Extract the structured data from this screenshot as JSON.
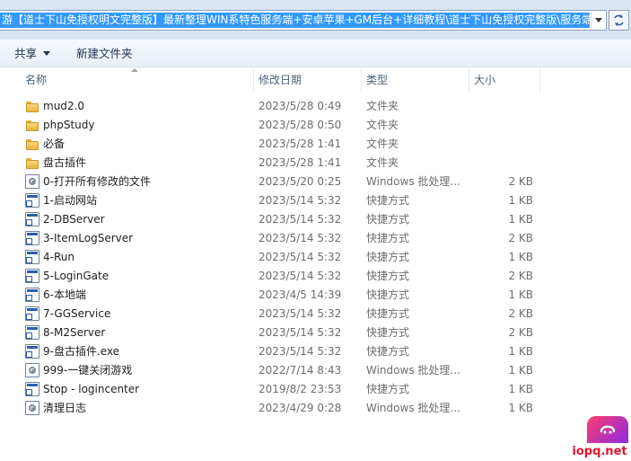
{
  "address_bar": {
    "path": "游【道士下山免授权明文完整版】最新整理WIN系特色服务端+安卓苹果+GM后台+详细教程\\道士下山免授权完整版\\服务端"
  },
  "toolbar": {
    "share_label": "共享",
    "new_folder_label": "新建文件夹"
  },
  "columns": {
    "name": "名称",
    "date": "修改日期",
    "type": "类型",
    "size": "大小"
  },
  "files": [
    {
      "name": "mud2.0",
      "date": "2023/5/28 0:49",
      "type": "文件夹",
      "size": "",
      "icon": "folder-icon"
    },
    {
      "name": "phpStudy",
      "date": "2023/5/28 0:50",
      "type": "文件夹",
      "size": "",
      "icon": "folder-icon"
    },
    {
      "name": "必备",
      "date": "2023/5/28 1:41",
      "type": "文件夹",
      "size": "",
      "icon": "folder-icon"
    },
    {
      "name": "盘古插件",
      "date": "2023/5/28 1:41",
      "type": "文件夹",
      "size": "",
      "icon": "folder-icon"
    },
    {
      "name": "0-打开所有修改的文件",
      "date": "2023/5/20 0:25",
      "type": "Windows 批处理...",
      "size": "2 KB",
      "icon": "batch-file-icon"
    },
    {
      "name": "1-启动网站",
      "date": "2023/5/14 5:32",
      "type": "快捷方式",
      "size": "1 KB",
      "icon": "shortcut-icon"
    },
    {
      "name": "2-DBServer",
      "date": "2023/5/14 5:32",
      "type": "快捷方式",
      "size": "1 KB",
      "icon": "shortcut-icon"
    },
    {
      "name": "3-ItemLogServer",
      "date": "2023/5/14 5:32",
      "type": "快捷方式",
      "size": "2 KB",
      "icon": "shortcut-icon"
    },
    {
      "name": "4-Run",
      "date": "2023/5/14 5:32",
      "type": "快捷方式",
      "size": "1 KB",
      "icon": "shortcut-icon"
    },
    {
      "name": "5-LoginGate",
      "date": "2023/5/14 5:32",
      "type": "快捷方式",
      "size": "2 KB",
      "icon": "shortcut-icon"
    },
    {
      "name": "6-本地端",
      "date": "2023/4/5 14:39",
      "type": "快捷方式",
      "size": "1 KB",
      "icon": "shortcut-icon"
    },
    {
      "name": "7-GGService",
      "date": "2023/5/14 5:32",
      "type": "快捷方式",
      "size": "2 KB",
      "icon": "shortcut-icon"
    },
    {
      "name": "8-M2Server",
      "date": "2023/5/14 5:32",
      "type": "快捷方式",
      "size": "2 KB",
      "icon": "shortcut-icon"
    },
    {
      "name": "9-盘古插件.exe",
      "date": "2023/5/14 5:32",
      "type": "快捷方式",
      "size": "1 KB",
      "icon": "shortcut-icon"
    },
    {
      "name": "999-一键关闭游戏",
      "date": "2022/7/14 8:43",
      "type": "Windows 批处理...",
      "size": "1 KB",
      "icon": "batch-file-icon"
    },
    {
      "name": "Stop - logincenter",
      "date": "2019/8/2 23:53",
      "type": "快捷方式",
      "size": "1 KB",
      "icon": "shortcut-icon"
    },
    {
      "name": "清理日志",
      "date": "2023/4/29 0:28",
      "type": "Windows 批处理...",
      "size": "1 KB",
      "icon": "batch-file-icon"
    }
  ],
  "watermark": {
    "text": "iopq.net"
  }
}
